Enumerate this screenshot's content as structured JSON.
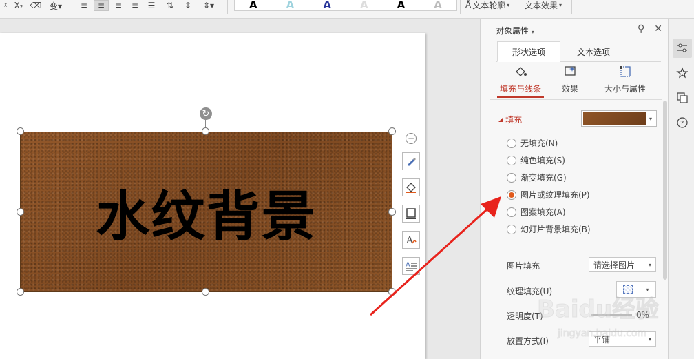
{
  "toolbar": {
    "shape_outline_label": "文本轮廓",
    "text_effect_label": "文本效果",
    "wordart_samples": [
      "A",
      "A",
      "A",
      "A",
      "A",
      "A"
    ],
    "wordart_colors": [
      "#000000",
      "#9fd3de",
      "#26349a",
      "#dddddd",
      "#000000",
      "#bbbbbb"
    ]
  },
  "slide": {
    "shape_text": "水纹背景",
    "shape_fill_color": "#8a5126"
  },
  "pane": {
    "title": "对象属性",
    "main_tabs": [
      {
        "label": "形状选项",
        "active": true
      },
      {
        "label": "文本选项",
        "active": false
      }
    ],
    "sub_tabs": [
      {
        "label": "填充与线条",
        "active": true
      },
      {
        "label": "效果",
        "active": false
      },
      {
        "label": "大小与属性",
        "active": false
      }
    ],
    "fill_section": {
      "label": "填充",
      "options": [
        {
          "label": "无填充(N)",
          "checked": false
        },
        {
          "label": "纯色填充(S)",
          "checked": false
        },
        {
          "label": "渐变填充(G)",
          "checked": false
        },
        {
          "label": "图片或纹理填充(P)",
          "checked": true
        },
        {
          "label": "图案填充(A)",
          "checked": false
        },
        {
          "label": "幻灯片背景填充(B)",
          "checked": false
        }
      ]
    },
    "picture_fill": {
      "label": "图片填充",
      "value": "请选择图片"
    },
    "texture_fill": {
      "label": "纹理填充(U)"
    },
    "transparency": {
      "label": "透明度(T)",
      "value": "0%"
    },
    "placement": {
      "label": "放置方式(I)",
      "value": "平铺"
    }
  },
  "accent_color": "#c0392b",
  "radio_checked_color": "#e05a1c",
  "annotation_arrow_color": "#e8231c",
  "watermark": {
    "brand": "Baidu经验",
    "url": "jingyan.baidu.com"
  }
}
